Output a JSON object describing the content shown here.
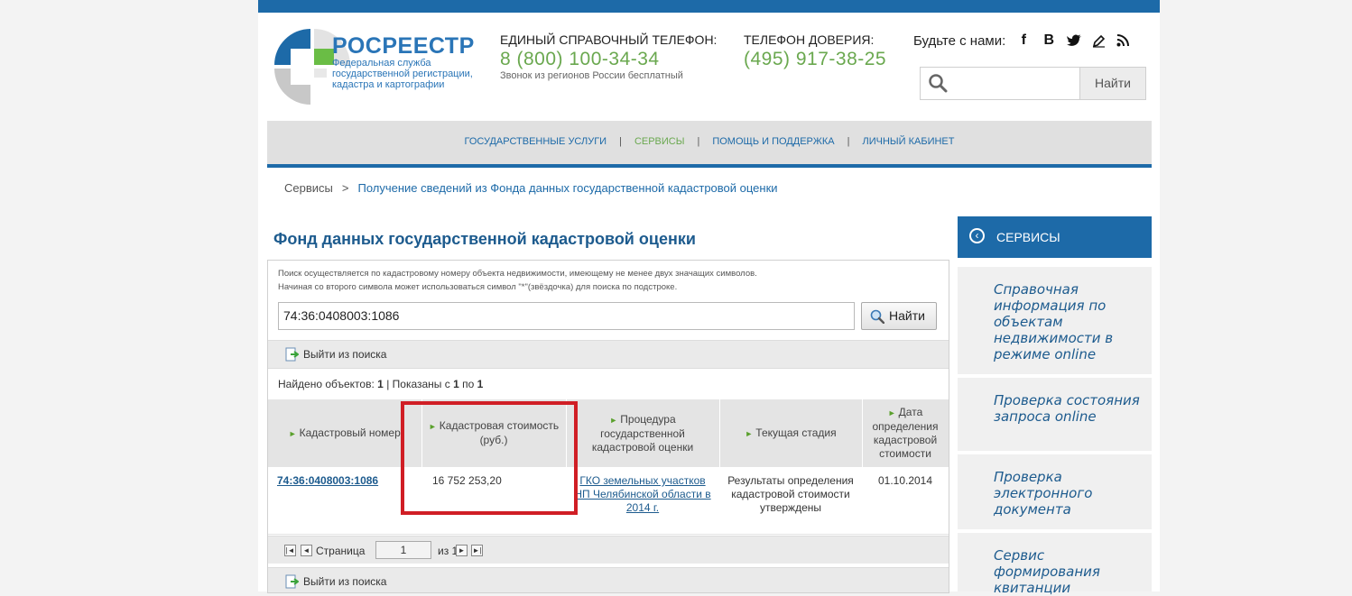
{
  "header": {
    "logo_title": "РОСРЕЕСТР",
    "logo_sub": [
      "Федеральная служба",
      "государственной регистрации,",
      "кадастра и картографии"
    ],
    "phone1_label": "ЕДИНЫЙ СПРАВОЧНЫЙ ТЕЛЕФОН:",
    "phone1_number": "8 (800) 100-34-34",
    "phone1_note": "Звонок из регионов России бесплатный",
    "phone2_label": "ТЕЛЕФОН ДОВЕРИЯ:",
    "phone2_number": "(495) 917-38-25",
    "social_label": "Будьте с нами:",
    "search_button": "Найти"
  },
  "nav": {
    "items": [
      "ГОСУДАРСТВЕННЫЕ УСЛУГИ",
      "СЕРВИСЫ",
      "ПОМОЩЬ И ПОДДЕРЖКА",
      "ЛИЧНЫЙ КАБИНЕТ"
    ],
    "separator": "|"
  },
  "breadcrumb": {
    "root": "Сервисы",
    "arrow": ">",
    "current": "Получение сведений из Фонда данных государственной кадастровой оценки"
  },
  "page_title": "Фонд данных государственной кадастровой оценки",
  "search": {
    "hint_line1": "Поиск осуществляется по кадастровому номеру объекта недвижимости, имеющему не менее двух значащих символов.",
    "hint_line2": "Начиная со второго символа может использоваться символ \"*\"(звёздочка) для поиска по подстроке.",
    "value": "74:36:0408003:1086",
    "button": "Найти",
    "exit_label": "Выйти из поиска"
  },
  "results": {
    "found_prefix": "Найдено объектов:",
    "found_count": "1",
    "shown_prefix": "| Показаны с",
    "shown_from": "1",
    "shown_to_word": "по",
    "shown_to": "1",
    "columns": [
      "Кадастровый номер",
      "Кадастровая стоимость (руб.)",
      "Процедура государственной кадастровой оценки",
      "Текущая стадия",
      "Дата определения кадастровой стоимости"
    ],
    "row": {
      "cad_number": "74:36:0408003:1086",
      "value": "16 752 253,20",
      "procedure": "ГКО земельных участков НП Челябинской области в 2014 г.",
      "stage": "Результаты определения кадастровой стоимости утверждены",
      "date": "01.10.2014"
    }
  },
  "pager": {
    "page_label": "Страница",
    "page_value": "1",
    "of_label": "из 1"
  },
  "sidebar": {
    "title": "СЕРВИСЫ",
    "items": [
      "Справочная информация по объектам недвижимости в режиме online",
      "Проверка состояния запроса online",
      "Проверка электронного документа",
      "Сервис формирования квитанции"
    ]
  },
  "colors": {
    "brand_blue": "#1d6aa8",
    "brand_green": "#6aa84f",
    "highlight_red": "#d01e25"
  }
}
